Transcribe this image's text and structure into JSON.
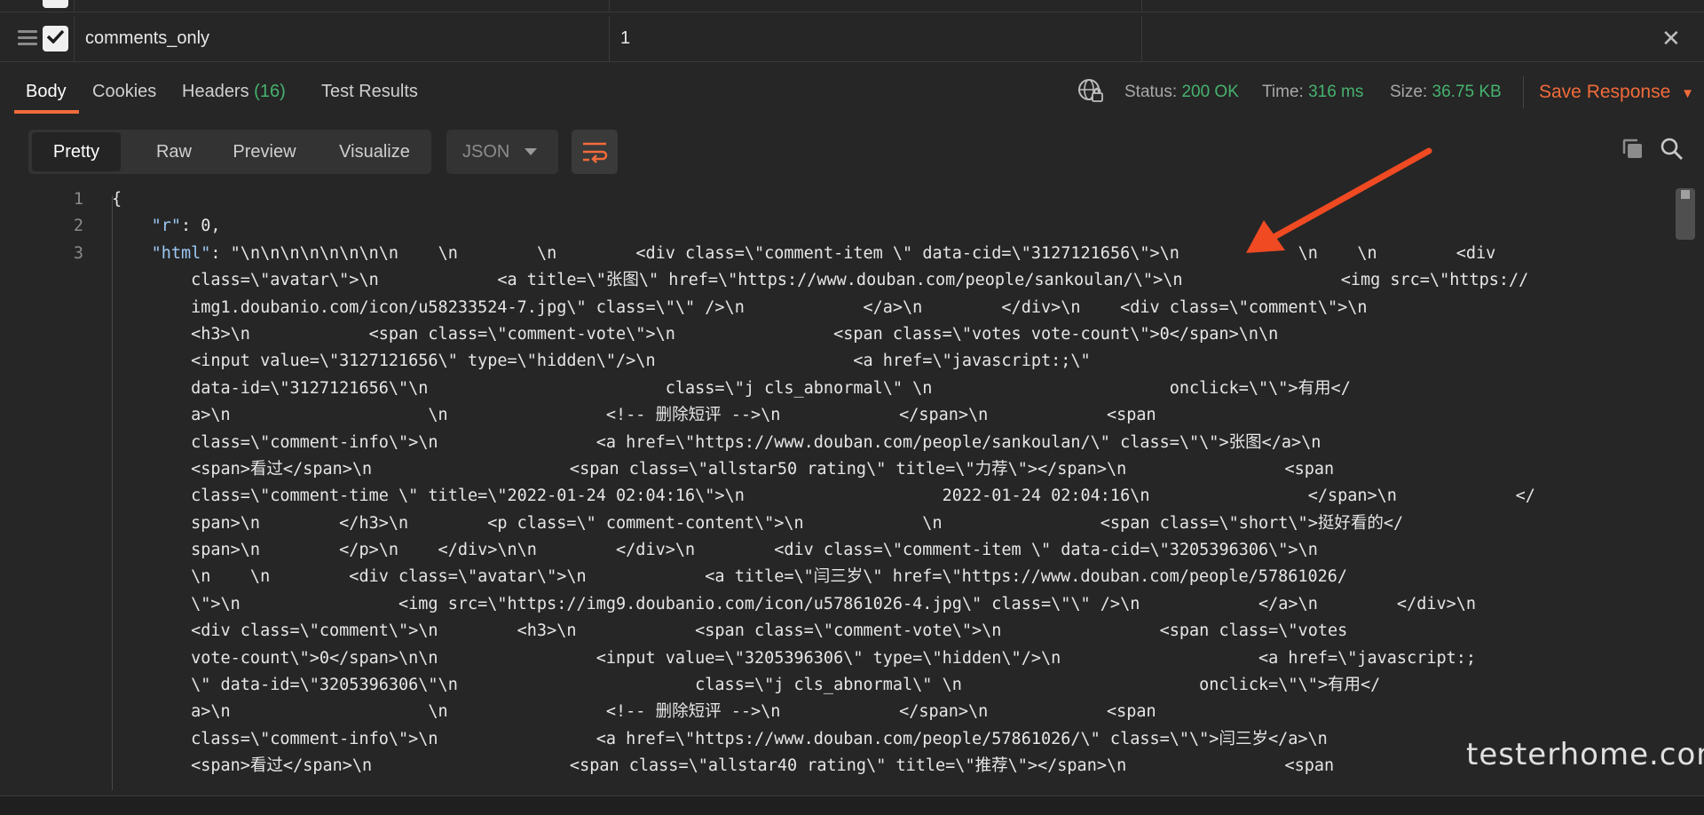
{
  "params": {
    "row_key": "comments_only",
    "row_value": "1"
  },
  "response_tabs": [
    {
      "label": "Body"
    },
    {
      "label": "Cookies"
    },
    {
      "label": "Headers ",
      "count": "(16)"
    },
    {
      "label": "Test Results"
    }
  ],
  "status": {
    "status_label": "Status:",
    "status_value": "200 OK",
    "time_label": "Time:",
    "time_value": "316 ms",
    "size_label": "Size:",
    "size_value": "36.75 KB",
    "save_label": "Save Response"
  },
  "view_modes": [
    "Pretty",
    "Raw",
    "Preview",
    "Visualize"
  ],
  "format": "JSON",
  "line_numbers": [
    "1",
    "2",
    "3"
  ],
  "code_lines": [
    "{",
    "    \"r\": 0,",
    "    \"html\": \"\\n\\n\\n\\n\\n\\n\\n\\n    \\n        \\n        <div class=\\\"comment-item \\\" data-cid=\\\"3127121656\\\">\\n            \\n    \\n        <div",
    "        class=\\\"avatar\\\">\\n            <a title=\\\"张图\\\" href=\\\"https://www.douban.com/people/sankoulan/\\\">\\n                <img src=\\\"https://",
    "        img1.doubanio.com/icon/u58233524-7.jpg\\\" class=\\\"\\\" />\\n            </a>\\n        </div>\\n    <div class=\\\"comment\\\">\\n",
    "        <h3>\\n            <span class=\\\"comment-vote\\\">\\n                <span class=\\\"votes vote-count\\\">0</span>\\n\\n",
    "        <input value=\\\"3127121656\\\" type=\\\"hidden\\\"/>\\n                    <a href=\\\"javascript:;\\\"",
    "        data-id=\\\"3127121656\\\"\\n                        class=\\\"j cls_abnormal\\\" \\n                        onclick=\\\"\\\">有用</",
    "        a>\\n                    \\n                <!-- 删除短评 -->\\n            </span>\\n            <span",
    "        class=\\\"comment-info\\\">\\n                <a href=\\\"https://www.douban.com/people/sankoulan/\\\" class=\\\"\\\">张图</a>\\n",
    "        <span>看过</span>\\n                    <span class=\\\"allstar50 rating\\\" title=\\\"力荐\\\"></span>\\n                <span",
    "        class=\\\"comment-time \\\" title=\\\"2022-01-24 02:04:16\\\">\\n                    2022-01-24 02:04:16\\n                </span>\\n            </",
    "        span>\\n        </h3>\\n        <p class=\\\" comment-content\\\">\\n            \\n                <span class=\\\"short\\\">挺好看的</",
    "        span>\\n        </p>\\n    </div>\\n\\n        </div>\\n        <div class=\\\"comment-item \\\" data-cid=\\\"3205396306\\\">\\n",
    "        \\n    \\n        <div class=\\\"avatar\\\">\\n            <a title=\\\"闫三岁\\\" href=\\\"https://www.douban.com/people/57861026/",
    "        \\\">\\n                <img src=\\\"https://img9.doubanio.com/icon/u57861026-4.jpg\\\" class=\\\"\\\" />\\n            </a>\\n        </div>\\n",
    "        <div class=\\\"comment\\\">\\n        <h3>\\n            <span class=\\\"comment-vote\\\">\\n                <span class=\\\"votes",
    "        vote-count\\\">0</span>\\n\\n                <input value=\\\"3205396306\\\" type=\\\"hidden\\\"/>\\n                    <a href=\\\"javascript:;",
    "        \\\" data-id=\\\"3205396306\\\"\\n                        class=\\\"j cls_abnormal\\\" \\n                        onclick=\\\"\\\">有用</",
    "        a>\\n                    \\n                <!-- 删除短评 -->\\n            </span>\\n            <span",
    "        class=\\\"comment-info\\\">\\n                <a href=\\\"https://www.douban.com/people/57861026/\\\" class=\\\"\\\">闫三岁</a>\\n",
    "        <span>看过</span>\\n                    <span class=\\\"allstar40 rating\\\" title=\\\"推荐\\\"></span>\\n                <span"
  ],
  "watermark": "testerhome.com",
  "colors": {
    "accent": "#f26b3a",
    "success": "#46b26e",
    "background": "#262626",
    "json_key": "#9cc8f5"
  }
}
